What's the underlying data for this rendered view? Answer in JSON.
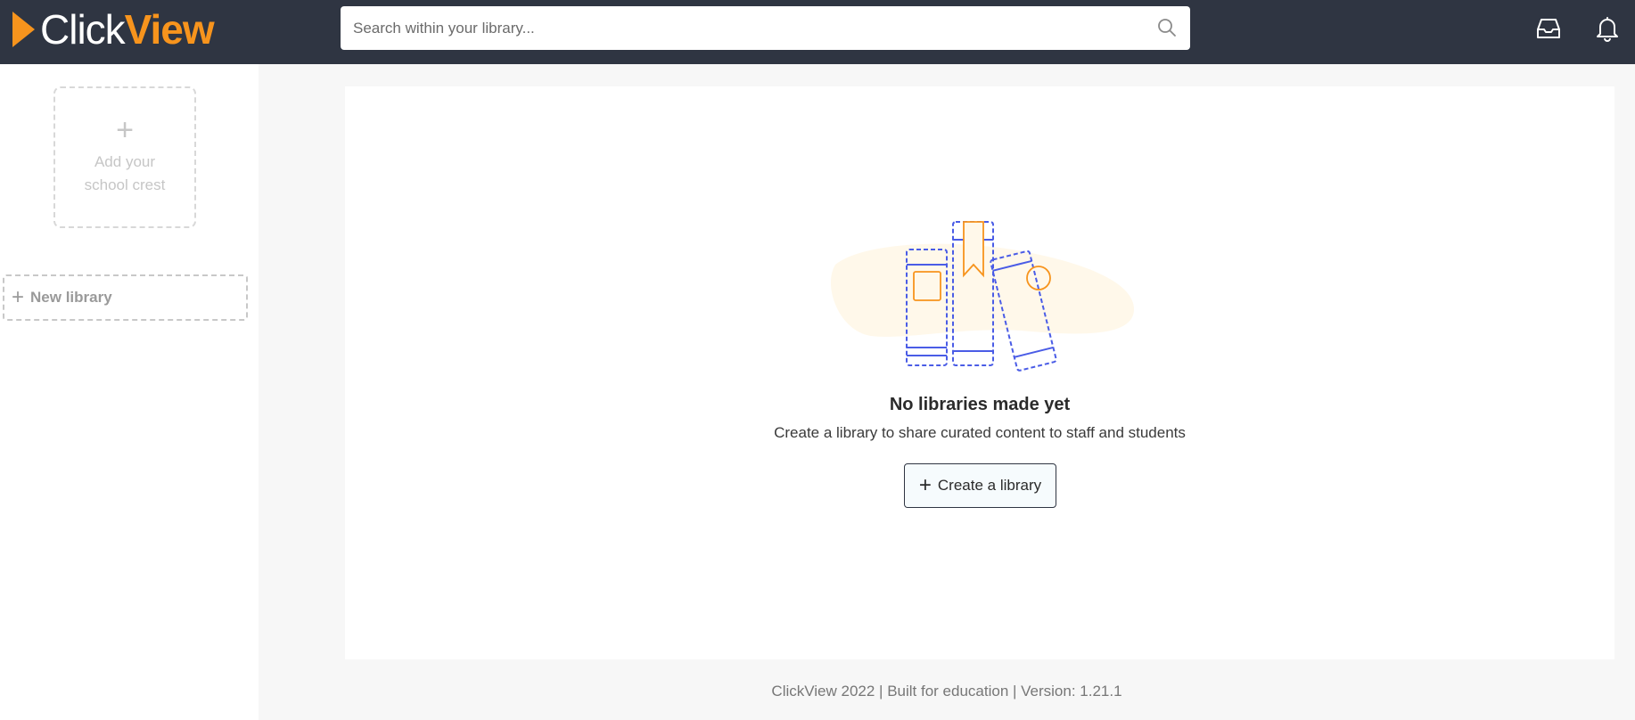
{
  "header": {
    "logo": {
      "part1": "Click",
      "part2": "View"
    },
    "search": {
      "placeholder": "Search within your library...",
      "value": ""
    },
    "icons": [
      "search-icon",
      "inbox-icon",
      "bell-icon"
    ]
  },
  "sidebar": {
    "crest": {
      "plus": "+",
      "text": "Add your school crest"
    },
    "new_library": {
      "plus": "+",
      "label": "New library"
    }
  },
  "main": {
    "empty_state": {
      "title": "No libraries made yet",
      "description": "Create a library to share curated content to staff and students",
      "button": {
        "plus": "+",
        "label": "Create a library"
      }
    }
  },
  "footer": {
    "text": "ClickView 2022 | Built for education | Version: 1.21.1"
  },
  "colors": {
    "header_bg": "#2f3542",
    "brand_orange": "#f7941d",
    "illustration_blue": "#4a5ce6",
    "illustration_blob": "#fff8ea"
  }
}
